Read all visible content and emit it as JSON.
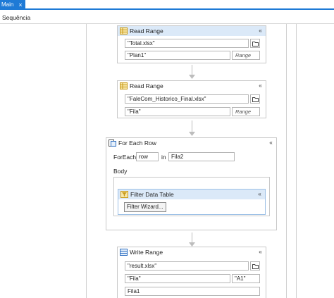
{
  "tabs": [
    {
      "label": "Main",
      "close": "×"
    }
  ],
  "breadcrumb": "Sequência",
  "activities": {
    "read_range_1": {
      "title": "Read Range",
      "workbook_path": "\"Total.xlsx\"",
      "sheet": "\"Plan1\"",
      "range_placeholder": "Range",
      "collapse": "«"
    },
    "read_range_2": {
      "title": "Read Range",
      "workbook_path": "\"FaleCom_Historico_Final.xlsx\"",
      "sheet": "\"Fila\"",
      "range_placeholder": "Range",
      "collapse": "«"
    },
    "for_each_row": {
      "title": "For Each Row",
      "foreach_label": "ForEach",
      "item_var": "row",
      "in_label": "in",
      "collection": "Fila2",
      "body_label": "Body",
      "collapse": "«",
      "filter_data_table": {
        "title": "Filter Data Table",
        "wizard_button": "Filter Wizard...",
        "collapse": "«"
      }
    },
    "write_range": {
      "title": "Write Range",
      "workbook_path": "\"result.xlsx\"",
      "sheet": "\"Fila\"",
      "start_cell": "\"A1\"",
      "datatable": "Fila1",
      "collapse": "«"
    }
  },
  "icons": {
    "excel_activity": "spreadsheet-icon",
    "folder": "folder-icon",
    "for_each": "for-each-icon",
    "write_range": "write-range-icon"
  },
  "colors": {
    "tab_accent": "#1e7ad6",
    "selected_header": "#dbe9f8",
    "excel_icon": "#d4a017"
  }
}
